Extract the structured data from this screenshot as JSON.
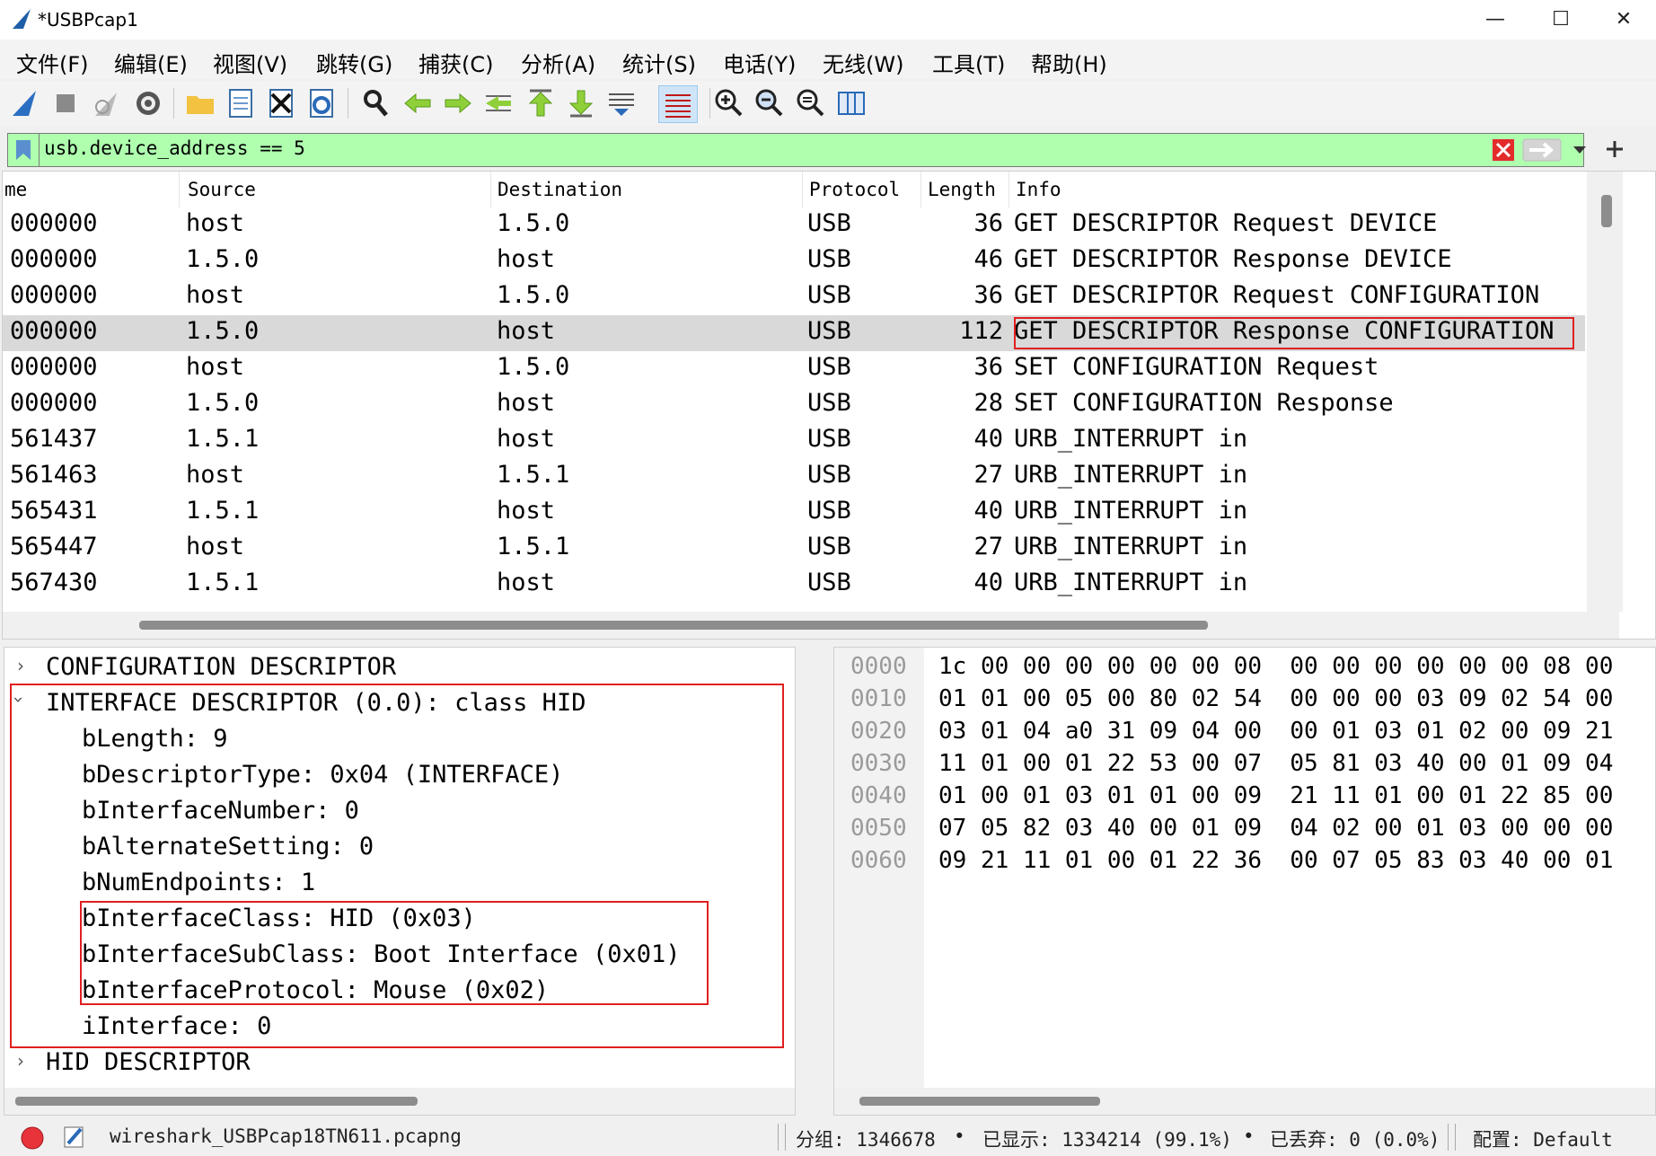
{
  "window": {
    "title": "*USBPcap1"
  },
  "menu": [
    "文件(F)",
    "编辑(E)",
    "视图(V)",
    "跳转(G)",
    "捕获(C)",
    "分析(A)",
    "统计(S)",
    "电话(Y)",
    "无线(W)",
    "工具(T)",
    "帮助(H)"
  ],
  "toolbar": {
    "icons": [
      "shark-fin-start-icon",
      "stop-square-icon",
      "restart-fin-icon",
      "capture-options-gear-icon",
      "open-folder-icon",
      "save-file-icon",
      "close-file-icon",
      "reload-file-icon",
      "find-packet-icon",
      "go-back-icon",
      "go-forward-icon",
      "go-to-packet-icon",
      "go-first-icon",
      "go-last-icon",
      "autoscroll-icon",
      "colorize-icon",
      "zoom-in-icon",
      "zoom-out-icon",
      "zoom-normal-icon",
      "resize-columns-icon"
    ]
  },
  "filter": {
    "value": "usb.device_address == 5"
  },
  "packet_list": {
    "columns": [
      "me",
      "Source",
      "Destination",
      "Protocol",
      "Length",
      "Info"
    ],
    "rows": [
      {
        "time": "000000",
        "src": "host",
        "dst": "1.5.0",
        "proto": "USB",
        "len": "36",
        "info": "GET DESCRIPTOR Request DEVICE"
      },
      {
        "time": "000000",
        "src": "1.5.0",
        "dst": "host",
        "proto": "USB",
        "len": "46",
        "info": "GET DESCRIPTOR Response DEVICE"
      },
      {
        "time": "000000",
        "src": "host",
        "dst": "1.5.0",
        "proto": "USB",
        "len": "36",
        "info": "GET DESCRIPTOR Request CONFIGURATION"
      },
      {
        "time": "000000",
        "src": "1.5.0",
        "dst": "host",
        "proto": "USB",
        "len": "112",
        "info": "GET DESCRIPTOR Response CONFIGURATION"
      },
      {
        "time": "000000",
        "src": "host",
        "dst": "1.5.0",
        "proto": "USB",
        "len": "36",
        "info": "SET CONFIGURATION Request"
      },
      {
        "time": "000000",
        "src": "1.5.0",
        "dst": "host",
        "proto": "USB",
        "len": "28",
        "info": "SET CONFIGURATION Response"
      },
      {
        "time": "561437",
        "src": "1.5.1",
        "dst": "host",
        "proto": "USB",
        "len": "40",
        "info": "URB_INTERRUPT in"
      },
      {
        "time": "561463",
        "src": "host",
        "dst": "1.5.1",
        "proto": "USB",
        "len": "27",
        "info": "URB_INTERRUPT in"
      },
      {
        "time": "565431",
        "src": "1.5.1",
        "dst": "host",
        "proto": "USB",
        "len": "40",
        "info": "URB_INTERRUPT in"
      },
      {
        "time": "565447",
        "src": "host",
        "dst": "1.5.1",
        "proto": "USB",
        "len": "27",
        "info": "URB_INTERRUPT in"
      },
      {
        "time": "567430",
        "src": "1.5.1",
        "dst": "host",
        "proto": "USB",
        "len": "40",
        "info": "URB_INTERRUPT in"
      }
    ]
  },
  "detail": {
    "lines": [
      "CONFIGURATION DESCRIPTOR",
      "INTERFACE DESCRIPTOR (0.0): class HID",
      "bLength: 9",
      "bDescriptorType: 0x04 (INTERFACE)",
      "bInterfaceNumber: 0",
      "bAlternateSetting: 0",
      "bNumEndpoints: 1",
      "bInterfaceClass: HID (0x03)",
      "bInterfaceSubClass: Boot Interface (0x01)",
      "bInterfaceProtocol: Mouse (0x02)",
      "iInterface: 0",
      "HID DESCRIPTOR"
    ]
  },
  "hex": {
    "rows": [
      {
        "offset": "0000",
        "bytes": "1c 00 00 00 00 00 00 00  00 00 00 00 00 00 08 00"
      },
      {
        "offset": "0010",
        "bytes": "01 01 00 05 00 80 02 54  00 00 00 03 09 02 54 00"
      },
      {
        "offset": "0020",
        "bytes": "03 01 04 a0 31 09 04 00  00 01 03 01 02 00 09 21"
      },
      {
        "offset": "0030",
        "bytes": "11 01 00 01 22 53 00 07  05 81 03 40 00 01 09 04"
      },
      {
        "offset": "0040",
        "bytes": "01 00 01 03 01 01 00 09  21 11 01 00 01 22 85 00"
      },
      {
        "offset": "0050",
        "bytes": "07 05 82 03 40 00 01 09  04 02 00 01 03 00 00 00"
      },
      {
        "offset": "0060",
        "bytes": "09 21 11 01 00 01 22 36  00 07 05 83 03 40 00 01"
      }
    ]
  },
  "status": {
    "file": "wireshark_USBPcap18TN611.pcapng",
    "packets": "分组: 1346678",
    "displayed": "已显示: 1334214 (99.1%)",
    "dropped": "已丢弃: 0 (0.0%)",
    "profile": "配置: Default"
  },
  "colors": {
    "filter_valid": "#afffaf",
    "highlight_box": "#e02020",
    "selected_row": "#d9d9d9"
  }
}
